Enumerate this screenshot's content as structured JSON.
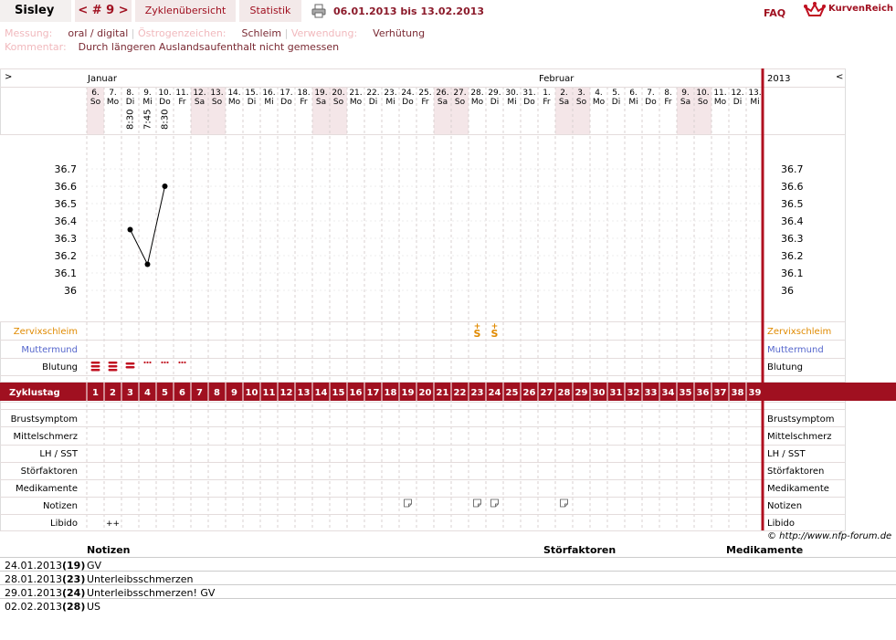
{
  "header": {
    "name": "Sisley",
    "cycle": "< # 9 >",
    "tab_overview": "Zyklenübersicht",
    "tab_stats": "Statistik",
    "date_range": "06.01.2013 bis 13.02.2013",
    "faq": "FAQ",
    "logo_text": "KurvenReich"
  },
  "info": {
    "measurement_label": "Messung:",
    "measurement_value": "oral / digital",
    "estrogen_label": "Östrogenzeichen:",
    "estrogen_value": "Schleim",
    "usage_label": "Verwendung:",
    "usage_value": "Verhütung",
    "comment_label": "Kommentar:",
    "comment_value": "Durch längeren Auslandsaufenthalt nicht gemessen"
  },
  "chart": {
    "nav_left": ">",
    "nav_right": "<",
    "year": "2013",
    "month_jan": "Januar",
    "month_feb": "Februar",
    "days": [
      {
        "d": "6.",
        "w": "So",
        "weekend": true
      },
      {
        "d": "7.",
        "w": "Mo",
        "weekend": false
      },
      {
        "d": "8.",
        "w": "Di",
        "weekend": false
      },
      {
        "d": "9.",
        "w": "Mi",
        "weekend": false
      },
      {
        "d": "10.",
        "w": "Do",
        "weekend": false
      },
      {
        "d": "11.",
        "w": "Fr",
        "weekend": false
      },
      {
        "d": "12.",
        "w": "Sa",
        "weekend": true
      },
      {
        "d": "13.",
        "w": "So",
        "weekend": true
      },
      {
        "d": "14.",
        "w": "Mo",
        "weekend": false
      },
      {
        "d": "15.",
        "w": "Di",
        "weekend": false
      },
      {
        "d": "16.",
        "w": "Mi",
        "weekend": false
      },
      {
        "d": "17.",
        "w": "Do",
        "weekend": false
      },
      {
        "d": "18.",
        "w": "Fr",
        "weekend": false
      },
      {
        "d": "19.",
        "w": "Sa",
        "weekend": true
      },
      {
        "d": "20.",
        "w": "So",
        "weekend": true
      },
      {
        "d": "21.",
        "w": "Mo",
        "weekend": false
      },
      {
        "d": "22.",
        "w": "Di",
        "weekend": false
      },
      {
        "d": "23.",
        "w": "Mi",
        "weekend": false
      },
      {
        "d": "24.",
        "w": "Do",
        "weekend": false
      },
      {
        "d": "25.",
        "w": "Fr",
        "weekend": false
      },
      {
        "d": "26.",
        "w": "Sa",
        "weekend": true
      },
      {
        "d": "27.",
        "w": "So",
        "weekend": true
      },
      {
        "d": "28.",
        "w": "Mo",
        "weekend": false
      },
      {
        "d": "29.",
        "w": "Di",
        "weekend": false
      },
      {
        "d": "30.",
        "w": "Mi",
        "weekend": false
      },
      {
        "d": "31.",
        "w": "Do",
        "weekend": false
      },
      {
        "d": "1.",
        "w": "Fr",
        "weekend": false
      },
      {
        "d": "2.",
        "w": "Sa",
        "weekend": true
      },
      {
        "d": "3.",
        "w": "So",
        "weekend": true
      },
      {
        "d": "4.",
        "w": "Mo",
        "weekend": false
      },
      {
        "d": "5.",
        "w": "Di",
        "weekend": false
      },
      {
        "d": "6.",
        "w": "Mi",
        "weekend": false
      },
      {
        "d": "7.",
        "w": "Do",
        "weekend": false
      },
      {
        "d": "8.",
        "w": "Fr",
        "weekend": false
      },
      {
        "d": "9.",
        "w": "Sa",
        "weekend": true
      },
      {
        "d": "10.",
        "w": "So",
        "weekend": true
      },
      {
        "d": "11.",
        "w": "Mo",
        "weekend": false
      },
      {
        "d": "12.",
        "w": "Di",
        "weekend": false
      },
      {
        "d": "13.",
        "w": "Mi",
        "weekend": false
      }
    ],
    "times": [
      {
        "day": 3,
        "time": "8:30"
      },
      {
        "day": 4,
        "time": "7:45"
      },
      {
        "day": 5,
        "time": "8:30"
      }
    ],
    "temp_ticks": [
      "36.7",
      "36.6",
      "36.5",
      "36.4",
      "36.3",
      "36.2",
      "36.1",
      "36"
    ],
    "temps": [
      {
        "day": 3,
        "value": 36.35
      },
      {
        "day": 4,
        "value": 36.15
      },
      {
        "day": 5,
        "value": 36.6
      }
    ],
    "rows_top": {
      "zervix": "Zervixschleim",
      "muttermund": "Muttermund",
      "blutung": "Blutung"
    },
    "zervix_marks": [
      {
        "day": 23,
        "symbol": "S+"
      },
      {
        "day": 24,
        "symbol": "S+"
      }
    ],
    "blutung_marks": [
      {
        "day": 1,
        "level": "heavy"
      },
      {
        "day": 2,
        "level": "heavy"
      },
      {
        "day": 3,
        "level": "medium"
      },
      {
        "day": 4,
        "level": "spotting"
      },
      {
        "day": 5,
        "level": "spotting"
      },
      {
        "day": 6,
        "level": "spotting"
      }
    ],
    "zyklustag_label": "Zyklustag",
    "cycle_days": [
      "1",
      "2",
      "3",
      "4",
      "5",
      "6",
      "7",
      "8",
      "9",
      "10",
      "11",
      "12",
      "13",
      "14",
      "15",
      "16",
      "17",
      "18",
      "19",
      "20",
      "21",
      "22",
      "23",
      "24",
      "25",
      "26",
      "27",
      "28",
      "29",
      "30",
      "31",
      "32",
      "33",
      "34",
      "35",
      "36",
      "37",
      "38",
      "39"
    ],
    "rows_bottom": [
      "Brustsymptom",
      "Mittelschmerz",
      "LH / SST",
      "Störfaktoren",
      "Medikamente",
      "Notizen",
      "Libido"
    ],
    "note_marks": [
      19,
      23,
      24,
      28
    ],
    "libido_marks": [
      {
        "day": 2,
        "text": "++"
      }
    ],
    "copyright": "© http://www.nfp-forum.de"
  },
  "footer": {
    "headers": {
      "notes": "Notizen",
      "disturb": "Störfaktoren",
      "meds": "Medikamente"
    },
    "rows": [
      {
        "date": "24.01.2013",
        "day": "(19)",
        "note": "GV"
      },
      {
        "date": "28.01.2013",
        "day": "(23)",
        "note": "Unterleibsschmerzen"
      },
      {
        "date": "29.01.2013",
        "day": "(24)",
        "note": "Unterleibsschmerzen! GV"
      },
      {
        "date": "02.02.2013",
        "day": "(28)",
        "note": "US"
      }
    ]
  },
  "colors": {
    "accent": "#a01020",
    "zervix": "#e08a00",
    "muttermund": "#5566cc",
    "weekend": "#f4e6e8",
    "grid": "#d8d0d0"
  }
}
